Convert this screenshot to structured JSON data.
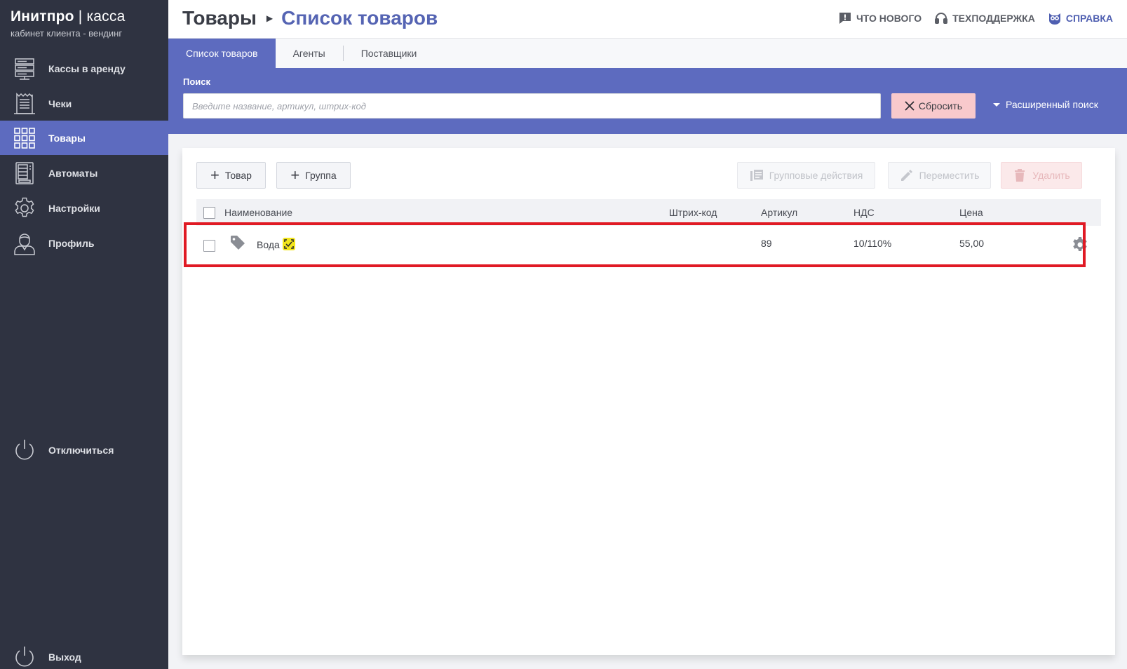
{
  "brand": {
    "title_bold": "Инитпро",
    "title_sep": " | ",
    "title_thin": "касса",
    "subtitle": "кабинет клиента - вендинг"
  },
  "sidebar": {
    "items": [
      {
        "label": "Кассы в аренду",
        "icon": "server-icon"
      },
      {
        "label": "Чеки",
        "icon": "receipt-icon"
      },
      {
        "label": "Товары",
        "icon": "grid-icon",
        "active": true
      },
      {
        "label": "Автоматы",
        "icon": "vending-machine-icon"
      },
      {
        "label": "Настройки",
        "icon": "gear-icon"
      },
      {
        "label": "Профиль",
        "icon": "user-icon"
      }
    ],
    "disconnect": "Отключиться",
    "logout": "Выход"
  },
  "header": {
    "breadcrumb_root": "Товары",
    "breadcrumb_current": "Список товаров",
    "links": {
      "whats_new": "Что нового",
      "support": "Техподдержка",
      "help": "Справка"
    }
  },
  "tabs": [
    {
      "label": "Список товаров",
      "active": true
    },
    {
      "label": "Агенты"
    },
    {
      "label": "Поставщики"
    }
  ],
  "search": {
    "label": "Поиск",
    "placeholder": "Введите название, артикул, штрих-код",
    "value": "",
    "reset_label": "Сбросить",
    "advanced_label": "Расширенный поиск"
  },
  "toolbar": {
    "add_product": "Товар",
    "add_group": "Группа",
    "group_actions": "Групповые действия",
    "move": "Переместить",
    "delete": "Удалить"
  },
  "table": {
    "columns": {
      "name": "Наименование",
      "barcode": "Штрих-код",
      "article": "Артикул",
      "vat": "НДС",
      "price": "Цена"
    },
    "rows": [
      {
        "name": "Вода",
        "barcode": "",
        "article": "89",
        "vat": "10/110%",
        "price": "55,00"
      }
    ]
  },
  "colors": {
    "sidebar_bg": "#2f3341",
    "accent": "#5d6bbf",
    "highlight": "#e01a24",
    "reset_bg": "#f8c9cc"
  }
}
